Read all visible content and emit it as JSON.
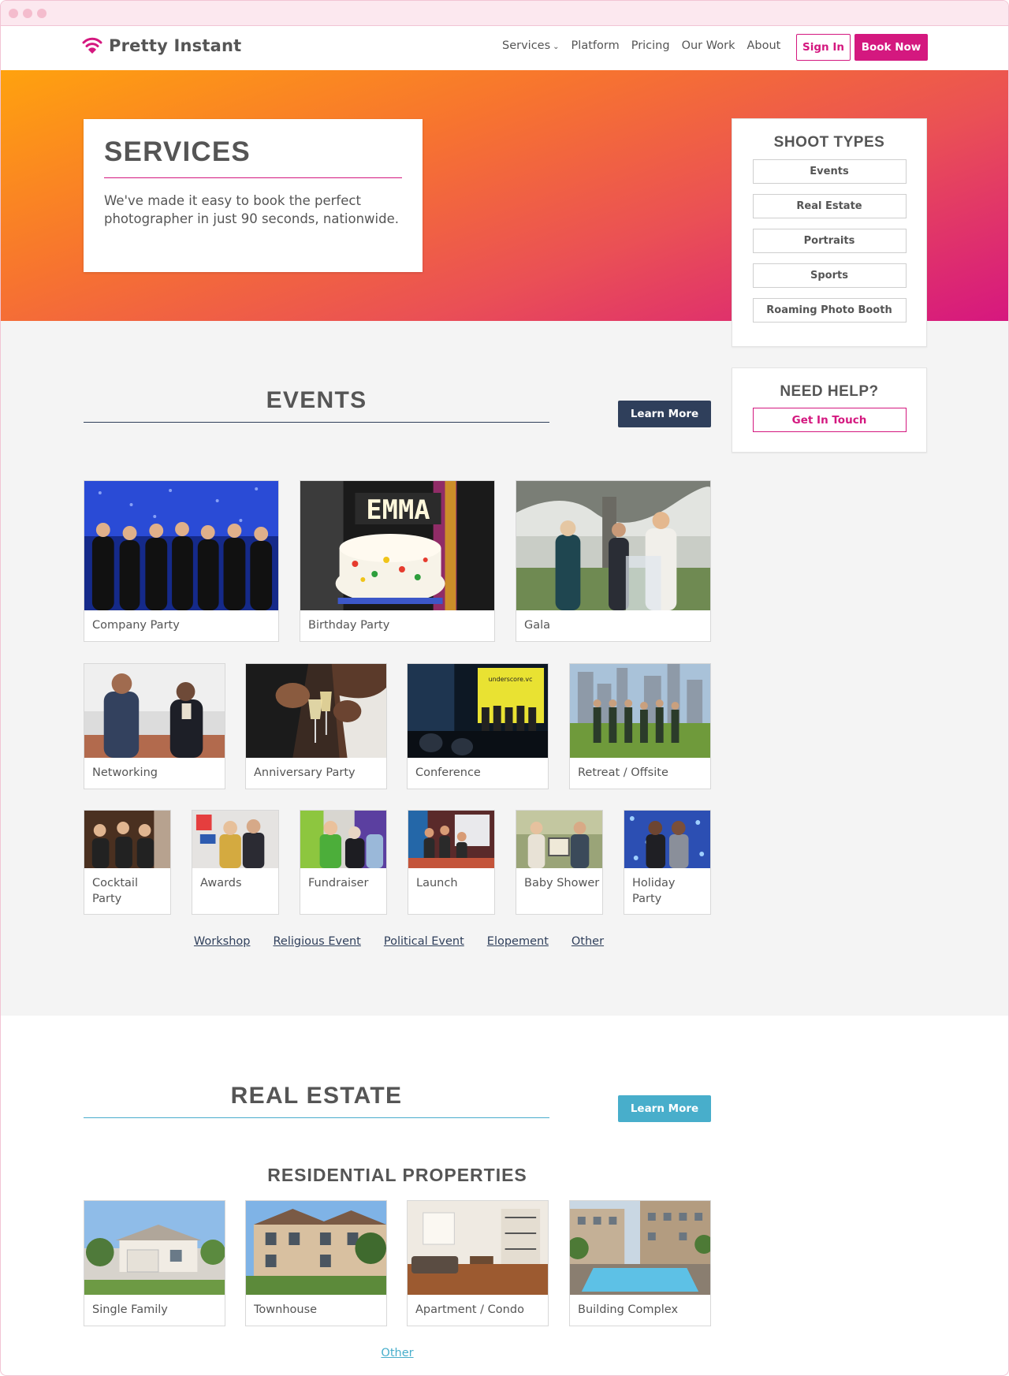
{
  "brand": {
    "name": "Pretty Instant",
    "accent": "#d4187f",
    "navy": "#2f3f5b",
    "teal": "#48aecb"
  },
  "nav": {
    "services": "Services",
    "platform": "Platform",
    "pricing": "Pricing",
    "our_work": "Our Work",
    "about": "About",
    "sign_in": "Sign In",
    "book_now": "Book Now"
  },
  "hero": {
    "title": "SERVICES",
    "description": "We've made it easy to book the perfect photographer in just 90 seconds, nationwide."
  },
  "sidebar": {
    "shoot_types_title": "SHOOT TYPES",
    "shoot_types": [
      "Events",
      "Real Estate",
      "Portraits",
      "Sports",
      "Roaming Photo Booth"
    ],
    "help_title": "NEED HELP?",
    "help_button": "Get In Touch"
  },
  "events": {
    "title": "EVENTS",
    "learn_more": "Learn More",
    "row1": [
      "Company Party",
      "Birthday Party",
      "Gala"
    ],
    "row2": [
      "Networking",
      "Anniversary Party",
      "Conference",
      "Retreat / Offsite"
    ],
    "row3": [
      "Cocktail Party",
      "Awards",
      "Fundraiser",
      "Launch",
      "Baby Shower",
      "Holiday Party"
    ],
    "more": [
      "Workshop",
      "Religious Event",
      "Political Event",
      "Elopement",
      "Other"
    ]
  },
  "real_estate": {
    "title": "REAL ESTATE",
    "learn_more": "Learn More",
    "residential_title": "RESIDENTIAL PROPERTIES",
    "residential": [
      "Single Family",
      "Townhouse",
      "Apartment / Condo",
      "Building Complex"
    ],
    "other": "Other"
  }
}
